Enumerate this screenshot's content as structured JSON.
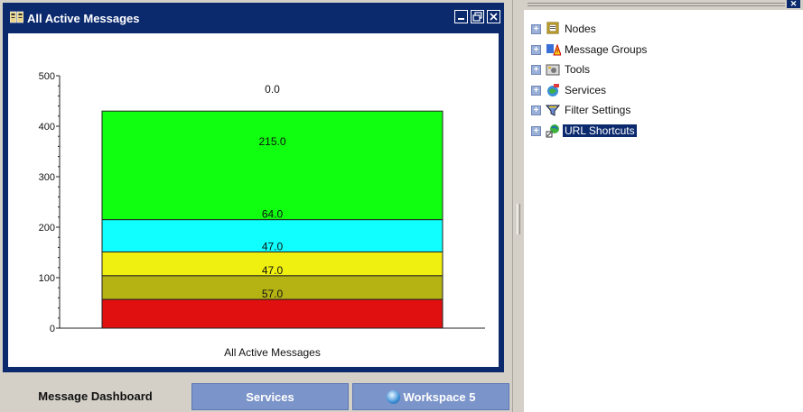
{
  "window": {
    "title": "All Active Messages"
  },
  "chart_data": {
    "type": "bar",
    "stacked": true,
    "categories": [
      "All Active Messages"
    ],
    "xlabel": "All Active Messages",
    "ylim": [
      0,
      500
    ],
    "yticks": [
      0,
      100,
      200,
      300,
      400,
      500
    ],
    "series": [
      {
        "value": 57,
        "label": "",
        "color": "#e01010"
      },
      {
        "value": 47,
        "label": "57.0",
        "color": "#b5b214"
      },
      {
        "value": 47,
        "label": "47.0",
        "color": "#f0f010"
      },
      {
        "value": 64,
        "label": "47.0",
        "color": "#10ffff"
      },
      {
        "value": 215,
        "label": "64.0",
        "color": "#10ff10"
      }
    ],
    "top_labels": [
      "215.0",
      "0.0"
    ],
    "grid": false
  },
  "tabs": [
    {
      "label": "Message Dashboard"
    },
    {
      "label": "Services"
    },
    {
      "label": "Workspace 5",
      "icon": "globe-icon"
    }
  ],
  "tree": [
    {
      "label": "Nodes",
      "icon": "nodes-icon",
      "selected": false
    },
    {
      "label": "Message Groups",
      "icon": "message-groups-icon",
      "selected": false
    },
    {
      "label": "Tools",
      "icon": "tools-icon",
      "selected": false
    },
    {
      "label": "Services",
      "icon": "services-icon",
      "selected": false
    },
    {
      "label": "Filter Settings",
      "icon": "filter-icon",
      "selected": false
    },
    {
      "label": "URL Shortcuts",
      "icon": "url-shortcuts-icon",
      "selected": true
    }
  ]
}
